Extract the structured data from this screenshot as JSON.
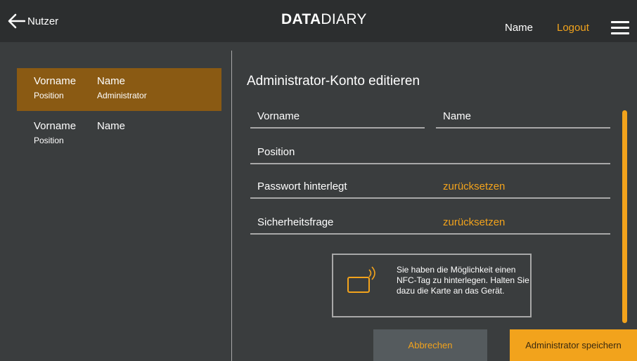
{
  "header": {
    "back_label": "Nutzer",
    "logo_bold": "DATA",
    "logo_light": "DIARY",
    "user_name": "Name",
    "logout_label": "Logout"
  },
  "users": [
    {
      "first": "Vorname",
      "last": "Name",
      "position": "Position",
      "role": "Administrator",
      "active": true
    },
    {
      "first": "Vorname",
      "last": "Name",
      "position": "Position",
      "role": "",
      "active": false
    }
  ],
  "form": {
    "title": "Administrator-Konto editieren",
    "firstname_label": "Vorname",
    "lastname_label": "Name",
    "position_label": "Position",
    "password_label": "Passwort hinterlegt",
    "password_action": "zurücksetzen",
    "security_label": "Sicherheitsfrage",
    "security_action": "zurücksetzen"
  },
  "nfc": {
    "text": "Sie haben die Möglichkeit einen NFC-Tag zu hinterlegen. Halten Sie dazu die Karte an das Gerät."
  },
  "buttons": {
    "cancel": "Abbrechen",
    "save": "Administrator speichern"
  },
  "colors": {
    "accent": "#f2a31c",
    "active_row": "#8a5a13",
    "background": "#3a3d3e",
    "topbar": "#2c2e2f"
  }
}
